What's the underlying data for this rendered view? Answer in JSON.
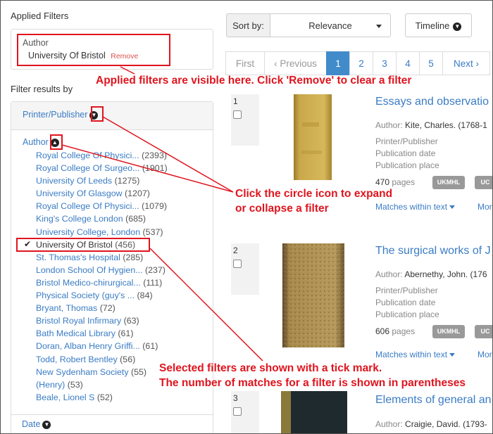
{
  "applied_filters": {
    "title": "Applied Filters",
    "facet": "Author",
    "value": "University Of Bristol",
    "remove_label": "Remove"
  },
  "filter_results_by": "Filter results by",
  "facets": {
    "printer_publisher": "Printer/Publisher",
    "author": "Author",
    "date": "Date"
  },
  "author_items": [
    {
      "name": "Royal College Of Physici...",
      "count": "(2393)"
    },
    {
      "name": "Royal College Of Surgeo...",
      "count": "(1901)"
    },
    {
      "name": "University Of Leeds",
      "count": "(1275)"
    },
    {
      "name": "University Of Glasgow",
      "count": "(1207)"
    },
    {
      "name": "Royal College Of Physici...",
      "count": "(1079)"
    },
    {
      "name": "King's College London",
      "count": "(685)"
    },
    {
      "name": "University College, London",
      "count": "(537)"
    },
    {
      "name": "University Of Bristol",
      "count": "(456)",
      "selected": true
    },
    {
      "name": "St. Thomas's Hospital",
      "count": "(285)"
    },
    {
      "name": "London School Of Hygien...",
      "count": "(237)"
    },
    {
      "name": "Bristol Medico-chirurgical...",
      "count": "(111)"
    },
    {
      "name": "Physical Society (guy's ...",
      "count": "(84)"
    },
    {
      "name": "Bryant, Thomas",
      "count": "(72)"
    },
    {
      "name": "Bristol Royal Infirmary",
      "count": "(63)"
    },
    {
      "name": "Bath Medical Library",
      "count": "(61)"
    },
    {
      "name": "Doran, Alban Henry Griffi...",
      "count": "(61)"
    },
    {
      "name": "Todd, Robert Bentley",
      "count": "(56)"
    },
    {
      "name": "New Sydenham Society",
      "count": "(55)"
    },
    {
      "name": "(Henry)",
      "count": "(53)"
    },
    {
      "name": "Beale, Lionel S",
      "count": "(52)"
    }
  ],
  "toolbar": {
    "sort_by_label": "Sort by:",
    "sort_value": "Relevance",
    "timeline_label": "Timeline"
  },
  "pagination": [
    "First",
    "‹ Previous",
    "1",
    "2",
    "3",
    "4",
    "5",
    "Next ›"
  ],
  "results": [
    {
      "num": "1",
      "title": "Essays and observatio",
      "author_label": "Author:",
      "author": "Kite, Charles. (1768-1",
      "printer_label": "Printer/Publisher",
      "date_label": "Publication date",
      "place_label": "Publication place",
      "pages": "470",
      "pages_label": "pages",
      "badge": "UKMHL",
      "badge2": "UC",
      "matches": "Matches within text",
      "more": "Mor"
    },
    {
      "num": "2",
      "title": "The surgical works of J",
      "author_label": "Author:",
      "author": "Abernethy, John. (176",
      "printer_label": "Printer/Publisher",
      "date_label": "Publication date",
      "place_label": "Publication place",
      "pages": "606",
      "pages_label": "pages",
      "badge": "UKMHL",
      "badge2": "UC",
      "matches": "Matches within text",
      "more": "Mor"
    },
    {
      "num": "3",
      "title": "Elements of general an",
      "author_label": "Author:",
      "author": "Craigie, David. (1793-"
    }
  ],
  "annotations": {
    "applied": "Applied filters are visible here. Click 'Remove' to clear a filter",
    "circle_line1": "Click the circle icon to expand",
    "circle_line2": "or collapse a filter",
    "selected_line1": "Selected filters are shown with a tick mark.",
    "selected_line2": "The number of matches for a filter is shown in parentheses"
  },
  "colors": {
    "link": "#3a7cc4",
    "annotation_red": "#e0141e",
    "active_page": "#428bca",
    "badge": "#999999",
    "book1_cover": "#c9a84a",
    "book2_cover": "#a88a4c",
    "book3_cover": "#1f2a2e"
  }
}
